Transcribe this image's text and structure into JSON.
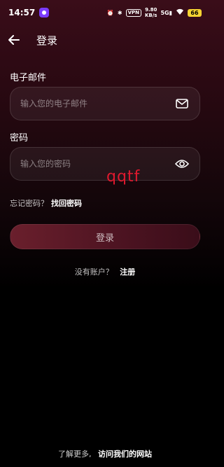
{
  "status": {
    "time": "14:57",
    "vpn": "VPN",
    "speed_value": "9.80",
    "speed_unit": "KB/s",
    "network": "5G",
    "battery": "66"
  },
  "header": {
    "title": "登录"
  },
  "form": {
    "email_label": "电子邮件",
    "email_placeholder": "输入您的电子邮件",
    "password_label": "密码",
    "password_placeholder": "输入您的密码",
    "forgot_prompt": "忘记密码？",
    "forgot_link": "找回密码",
    "login_button": "登录"
  },
  "signup": {
    "prompt": "没有账户？",
    "link": "注册"
  },
  "watermark": "qqtf",
  "footer": {
    "prompt": "了解更多,",
    "link": "访问我们的网站"
  },
  "colors": {
    "accent": "#6a1f2c",
    "watermark": "#e0192e",
    "battery": "#f5d432"
  }
}
